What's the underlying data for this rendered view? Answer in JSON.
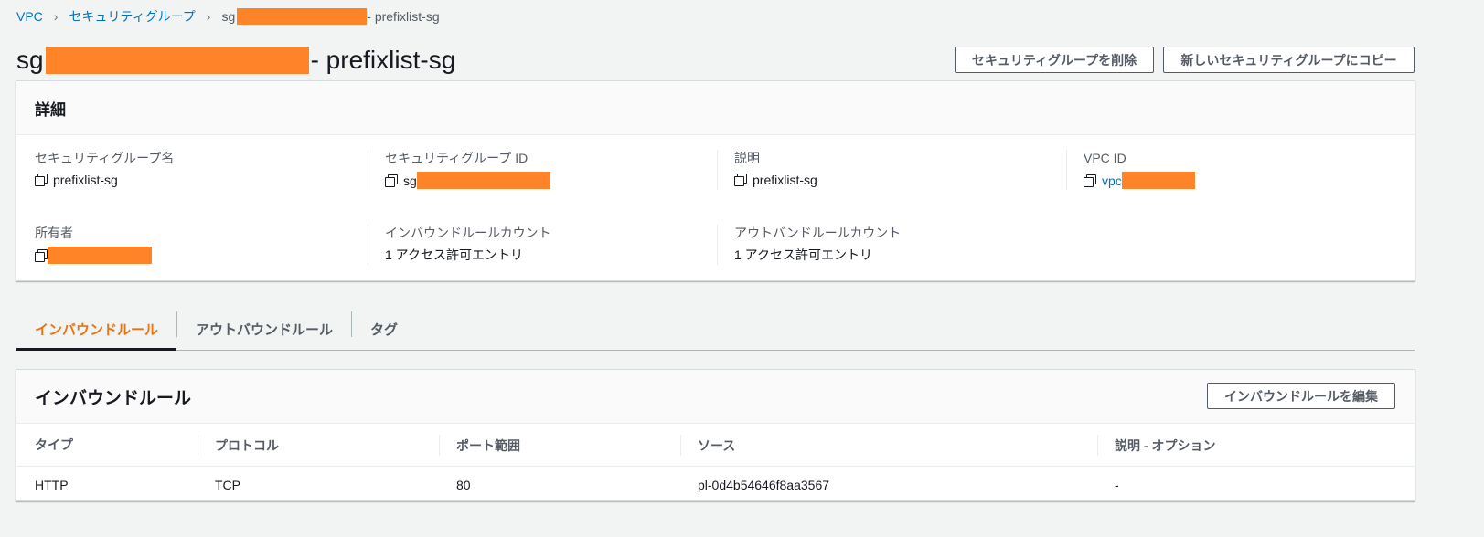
{
  "breadcrumb": {
    "items": [
      "VPC",
      "セキュリティグループ"
    ],
    "current_prefix": "sg",
    "current_suffix": "- prefixlist-sg"
  },
  "header": {
    "title_prefix": "sg",
    "title_suffix": "- prefixlist-sg",
    "delete_button": "セキュリティグループを削除",
    "copy_button": "新しいセキュリティグループにコピー"
  },
  "details": {
    "heading": "詳細",
    "sg_name_label": "セキュリティグループ名",
    "sg_name_value": "prefixlist-sg",
    "sg_id_label": "セキュリティグループ ID",
    "sg_id_prefix": "sg",
    "description_label": "説明",
    "description_value": "prefixlist-sg",
    "vpc_id_label": "VPC ID",
    "vpc_id_prefix": "vpc",
    "owner_label": "所有者",
    "inbound_count_label": "インバウンドルールカウント",
    "inbound_count_value": "1 アクセス許可エントリ",
    "outbound_count_label": "アウトバンドルールカウント",
    "outbound_count_value": "1 アクセス許可エントリ"
  },
  "tabs": [
    {
      "label": "インバウンドルール",
      "active": true
    },
    {
      "label": "アウトバウンドルール",
      "active": false
    },
    {
      "label": "タグ",
      "active": false
    }
  ],
  "rules": {
    "heading": "インバウンドルール",
    "edit_button": "インバウンドルールを編集",
    "columns": [
      "タイプ",
      "プロトコル",
      "ポート範囲",
      "ソース",
      "説明 - オプション"
    ],
    "rows": [
      [
        "HTTP",
        "TCP",
        "80",
        "pl-0d4b54646f8aa3567",
        "-"
      ]
    ]
  },
  "colors": {
    "accent_orange": "#ec7211",
    "link_blue": "#0073bb",
    "redaction": "#ff8428"
  }
}
